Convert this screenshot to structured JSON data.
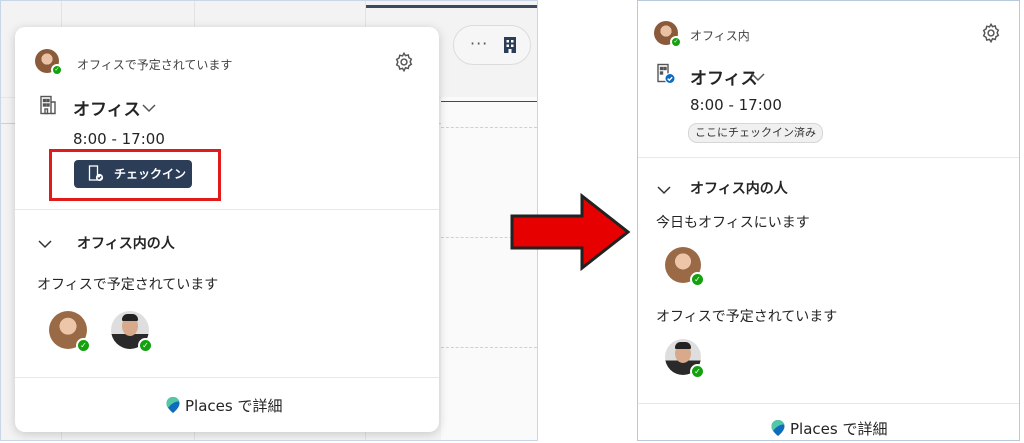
{
  "left": {
    "status_text": "オフィスで予定されています",
    "location_title": "オフィス",
    "time_range": "8:00 - 17:00",
    "checkin_label": "チェックイン",
    "people_section_title": "オフィス内の人",
    "scheduled_label": "オフィスで予定されています",
    "places_link_brand": "Places",
    "places_link_suffix": " で詳細",
    "toolbar_more": "···"
  },
  "right": {
    "status_text": "オフィス内",
    "location_title": "オフィス",
    "time_range": "8:00 - 17:00",
    "checked_in_chip": "ここにチェックイン済み",
    "people_section_title": "オフィス内の人",
    "today_label": "今日もオフィスにいます",
    "scheduled_label": "オフィスで予定されています",
    "places_link_brand": "Places",
    "places_link_suffix": " で詳細"
  },
  "colors": {
    "accent_dark": "#2b3d57",
    "presence_green": "#13a10e",
    "highlight_red": "#e11a1a",
    "arrow_red": "#e60000",
    "places_blue": "#0f6cbd"
  },
  "icons": [
    "building-icon",
    "gear-icon",
    "chevron-down-icon",
    "checkin-icon",
    "places-logo-icon",
    "more-icon"
  ]
}
